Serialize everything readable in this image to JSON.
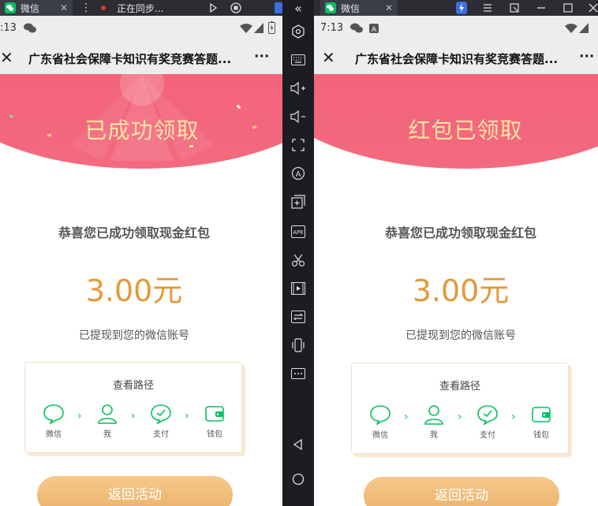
{
  "left": {
    "tabs": [
      {
        "label": "微信",
        "close": "✕"
      },
      {
        "label": "正在同步..."
      }
    ],
    "status_time": ":13",
    "nav_title": "广东省社会保障卡知识有奖竞赛答题...",
    "nav_more": "···",
    "hero_text": "已成功领取",
    "congrats": "恭喜您已成功领取现金红包",
    "amount": "3.00元",
    "note": "已提现到您的微信账号",
    "path_title": "查看路径",
    "steps": [
      {
        "label": "微信",
        "icon": "chat-bubble-icon"
      },
      {
        "label": "我",
        "icon": "person-icon"
      },
      {
        "label": "支付",
        "icon": "check-bubble-icon"
      },
      {
        "label": "钱包",
        "icon": "wallet-icon"
      }
    ],
    "back_button": "返回活动"
  },
  "right": {
    "tabs": [
      {
        "label": "微信",
        "close": "✕"
      }
    ],
    "status_time": "7:13",
    "nav_title": "广东省社会保障卡知识有奖竞赛答题...",
    "nav_more": "···",
    "hero_text": "红包已领取",
    "congrats": "恭喜您已成功领取现金红包",
    "amount": "3.00元",
    "note": "已提现到您的微信账号",
    "path_title": "查看路径",
    "steps": [
      {
        "label": "微信",
        "icon": "chat-bubble-icon"
      },
      {
        "label": "我",
        "icon": "person-icon"
      },
      {
        "label": "支付",
        "icon": "check-bubble-icon"
      },
      {
        "label": "钱包",
        "icon": "wallet-icon"
      }
    ],
    "back_button": "返回活动"
  },
  "colors": {
    "hero_pink": "#f2546e",
    "gold_text": "#ffe6a6",
    "amount_orange": "#e29a3a",
    "wechat_green": "#07c160",
    "button_gold": "#eab06b"
  }
}
